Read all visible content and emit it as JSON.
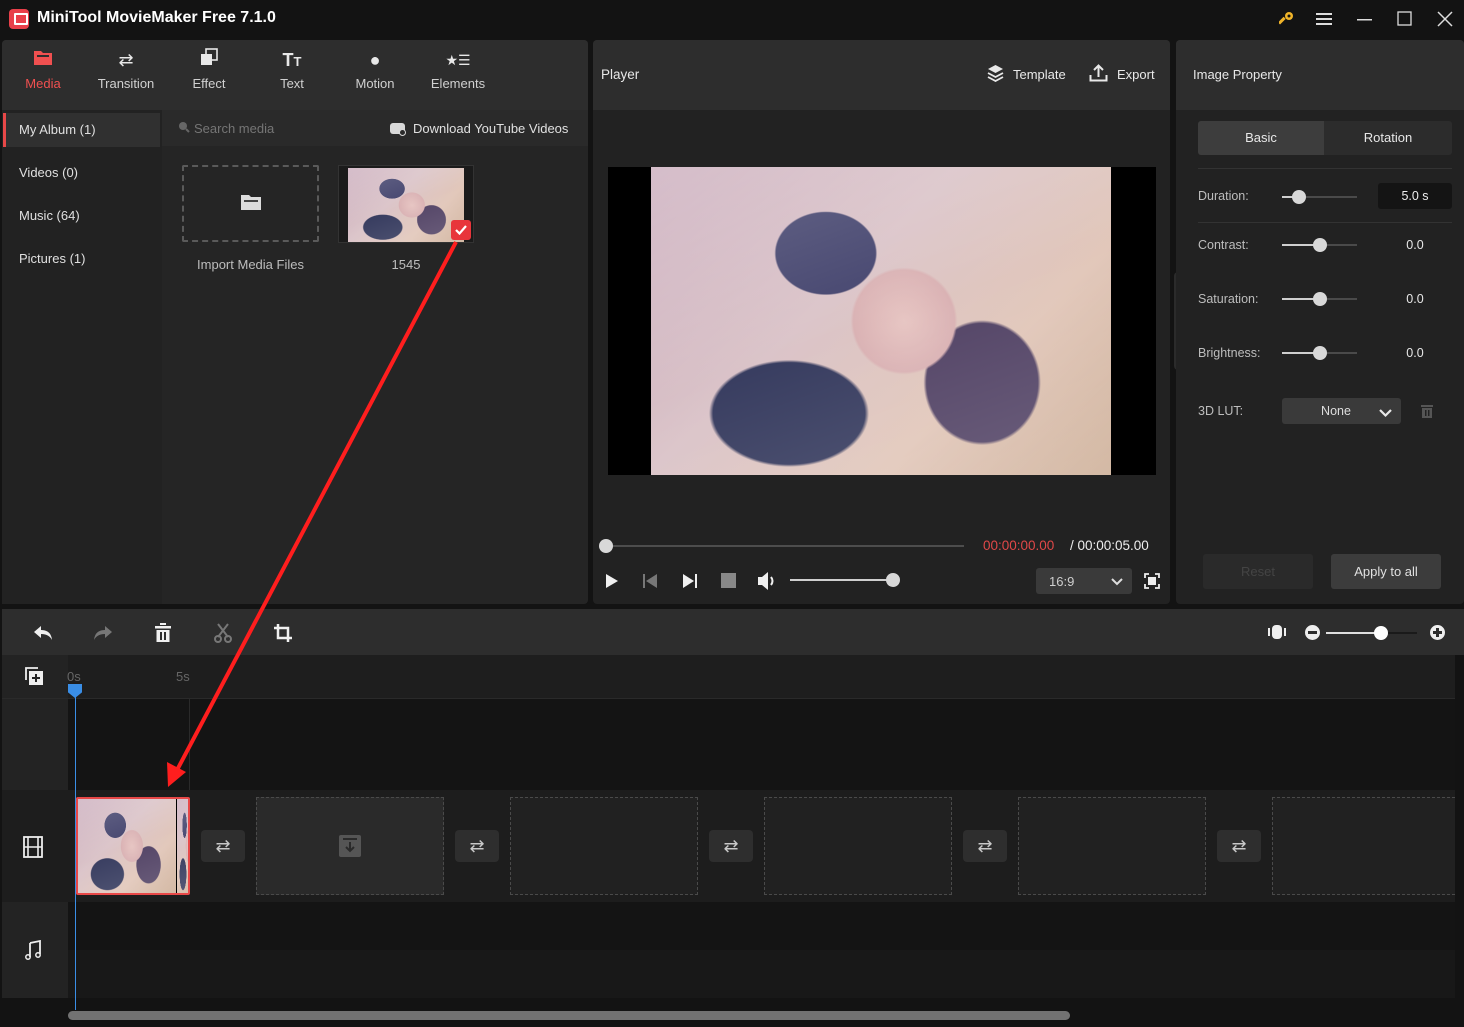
{
  "app": {
    "title": "MiniTool MovieMaker Free 7.1.0",
    "window_controls": [
      "key-icon",
      "menu-icon",
      "minimize-icon",
      "maximize-icon",
      "close-icon"
    ]
  },
  "toolbar": {
    "tabs": [
      {
        "label": "Media",
        "icon": "folder-icon",
        "active": true
      },
      {
        "label": "Transition",
        "icon": "swap-icon",
        "active": false
      },
      {
        "label": "Effect",
        "icon": "effect-icon",
        "active": false
      },
      {
        "label": "Text",
        "icon": "text-icon",
        "active": false
      },
      {
        "label": "Motion",
        "icon": "motion-icon",
        "active": false
      },
      {
        "label": "Elements",
        "icon": "elements-icon",
        "active": false
      }
    ]
  },
  "media": {
    "sidebar": [
      {
        "label": "My Album (1)",
        "active": true
      },
      {
        "label": "Videos (0)",
        "active": false
      },
      {
        "label": "Music (64)",
        "active": false
      },
      {
        "label": "Pictures (1)",
        "active": false
      }
    ],
    "search_placeholder": "Search media",
    "download_label": "Download YouTube Videos",
    "items": [
      {
        "label": "Import Media Files",
        "type": "import"
      },
      {
        "label": "1545",
        "type": "image",
        "selected": true
      }
    ]
  },
  "player": {
    "title": "Player",
    "template_label": "Template",
    "export_label": "Export",
    "progress": 0.0,
    "current_time": "00:00:00.00",
    "total_time": "/ 00:00:05.00",
    "volume": 1.0,
    "aspect_ratio": "16:9",
    "current_time_color": "#e04848"
  },
  "properties": {
    "title": "Image Property",
    "tabs": [
      {
        "label": "Basic",
        "active": true
      },
      {
        "label": "Rotation",
        "active": false
      }
    ],
    "rows": [
      {
        "label": "Duration:",
        "value": "5.0 s",
        "fraction": 0.22
      },
      {
        "label": "Contrast:",
        "value": "0.0",
        "fraction": 0.5
      },
      {
        "label": "Saturation:",
        "value": "0.0",
        "fraction": 0.5
      },
      {
        "label": "Brightness:",
        "value": "0.0",
        "fraction": 0.5
      }
    ],
    "lut_label": "3D LUT:",
    "lut_value": "None",
    "reset_label": "Reset",
    "apply_label": "Apply to all"
  },
  "timeline": {
    "ruler": [
      "0s",
      "5s"
    ],
    "zoom": 0.6,
    "clip_count": 1,
    "accent": "#3a8ee6"
  }
}
